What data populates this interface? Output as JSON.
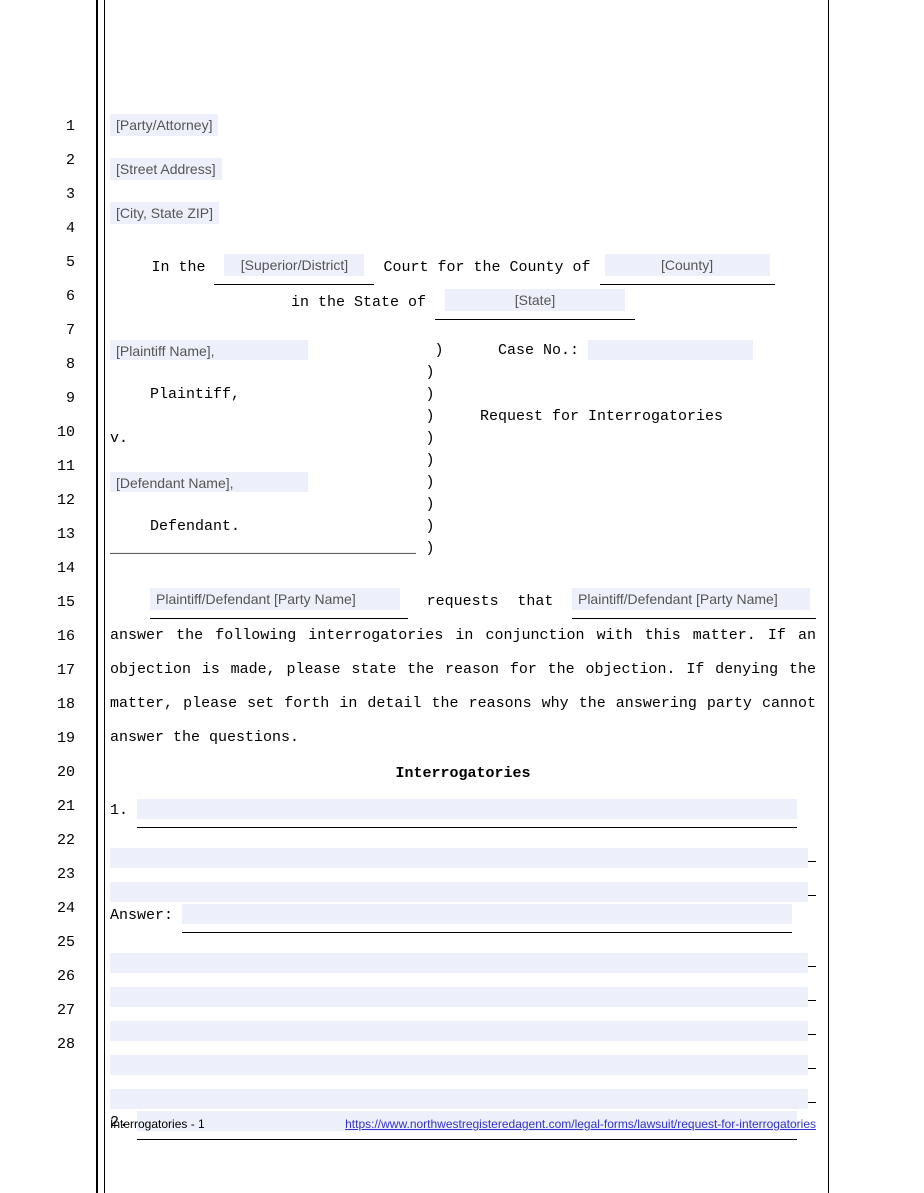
{
  "header": {
    "party_attorney": "[Party/Attorney]",
    "street_address": "[Street Address]",
    "city_state_zip": "[City, State ZIP]"
  },
  "court": {
    "in_the": "In the",
    "court_type": "[Superior/District]",
    "court_for_county": "Court for the County of",
    "county": "[County]",
    "in_state_of": "in the State of",
    "state": "[State]"
  },
  "caption": {
    "plaintiff_name": "[Plaintiff Name],",
    "plaintiff_label": "Plaintiff,",
    "vs": "v.",
    "defendant_name": "[Defendant Name],",
    "defendant_label": "Defendant.",
    "case_no_label": "Case No.:",
    "doc_title": "Request for Interrogatories",
    "separator": "__________________________________"
  },
  "body": {
    "requester": "Plaintiff/Defendant [Party Name]",
    "requests_that": "requests that",
    "requestee": "Plaintiff/Defendant [Party Name]",
    "paragraph": "answer the following interrogatories in conjunction with this matter. If an objection is made, please state the reason for the objection. If denying the matter, please set forth in detail the reasons why the answering party cannot answer the questions.",
    "section_title": "Interrogatories",
    "item1_label": "1.",
    "answer_label": "Answer:",
    "item2_label": "2."
  },
  "footer": {
    "left": "Interrogatories - 1",
    "url": "https://www.northwestregisteredagent.com/legal-forms/lawsuit/request-for-interrogatories"
  },
  "line_numbers": [
    "1",
    "2",
    "3",
    "4",
    "5",
    "6",
    "7",
    "8",
    "9",
    "10",
    "11",
    "12",
    "13",
    "14",
    "15",
    "16",
    "17",
    "18",
    "19",
    "20",
    "21",
    "22",
    "23",
    "24",
    "25",
    "26",
    "27",
    "28"
  ]
}
